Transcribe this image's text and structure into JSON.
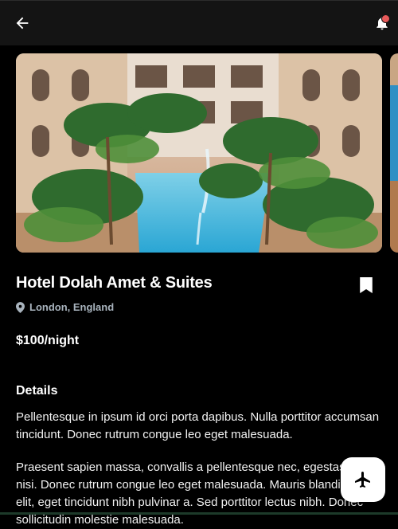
{
  "appbar": {
    "back_icon": "arrow-back-icon",
    "notification_icon": "bell-icon",
    "notification_dot_color": "#e85a5a"
  },
  "gallery": {
    "images": [
      "hotel-pool-courtyard-photo",
      "hotel-next-photo-partial"
    ]
  },
  "hotel": {
    "name": "Hotel Dolah Amet & Suites",
    "location": "London, England",
    "price": "$100/night",
    "bookmark_icon": "bookmark-icon"
  },
  "details": {
    "heading": "Details",
    "paragraphs": [
      "Pellentesque in ipsum id orci porta dapibus. Nulla porttitor accumsan tincidunt. Donec rutrum congue leo eget malesuada.",
      "Praesent sapien massa, convallis a pellentesque nec, egestas non nisi. Donec rutrum congue leo eget malesuada. Mauris blandit aliquet elit, eget tincidunt nibh pulvinar a. Sed porttitor lectus nibh. Donec sollicitudin molestie malesuada."
    ]
  },
  "fab": {
    "icon": "airplane-icon"
  },
  "colors": {
    "background": "#000000",
    "appbar": "#141414",
    "location_text": "#a8b3bd"
  }
}
